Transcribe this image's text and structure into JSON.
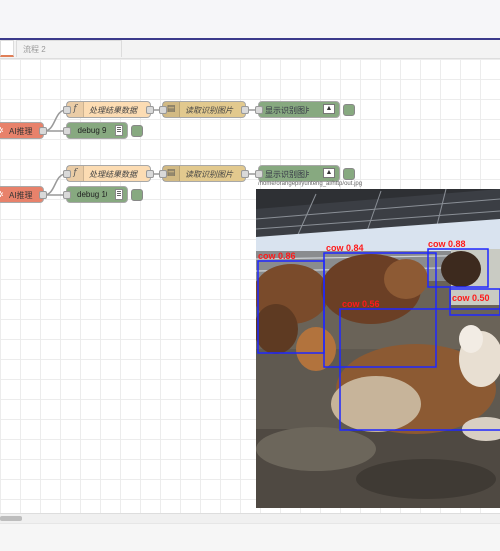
{
  "tabs": [
    {
      "label": "",
      "active": true
    },
    {
      "label": "流程 2",
      "active": false
    }
  ],
  "flows": [
    {
      "ai_label": "AI推理",
      "function_label": "处理结果数据",
      "store_label": "读取识别图片",
      "display_label": "显示识别图片",
      "debug_label": "debug 9"
    },
    {
      "ai_label": "AI推理",
      "function_label": "处理结果数据",
      "store_label": "读取识别图片",
      "display_label": "显示识别图片",
      "debug_label": "debug 10"
    }
  ],
  "result": {
    "path": "/home/orangepi/yunteng_ai/http/out.jpg",
    "detections": [
      {
        "label": "cow",
        "score": "0.86"
      },
      {
        "label": "cow",
        "score": "0.84"
      },
      {
        "label": "cow",
        "score": "0.56"
      },
      {
        "label": "cow",
        "score": "0.88"
      },
      {
        "label": "cow",
        "score": "0.50"
      }
    ]
  },
  "icons": {
    "function": "function-icon",
    "file": "file-icon",
    "image": "image-icon",
    "ai": "gear-icon",
    "debug": "list-icon"
  },
  "colors": {
    "accent": "#3b3a8c",
    "active_tab": "#e07f58",
    "ai_node": "#e8826b",
    "function_node": "#fcdcb3",
    "store_node": "#e2c98e",
    "display_node": "#87a980",
    "box": "#1f27ff",
    "box_label": "#ff1a1a"
  }
}
